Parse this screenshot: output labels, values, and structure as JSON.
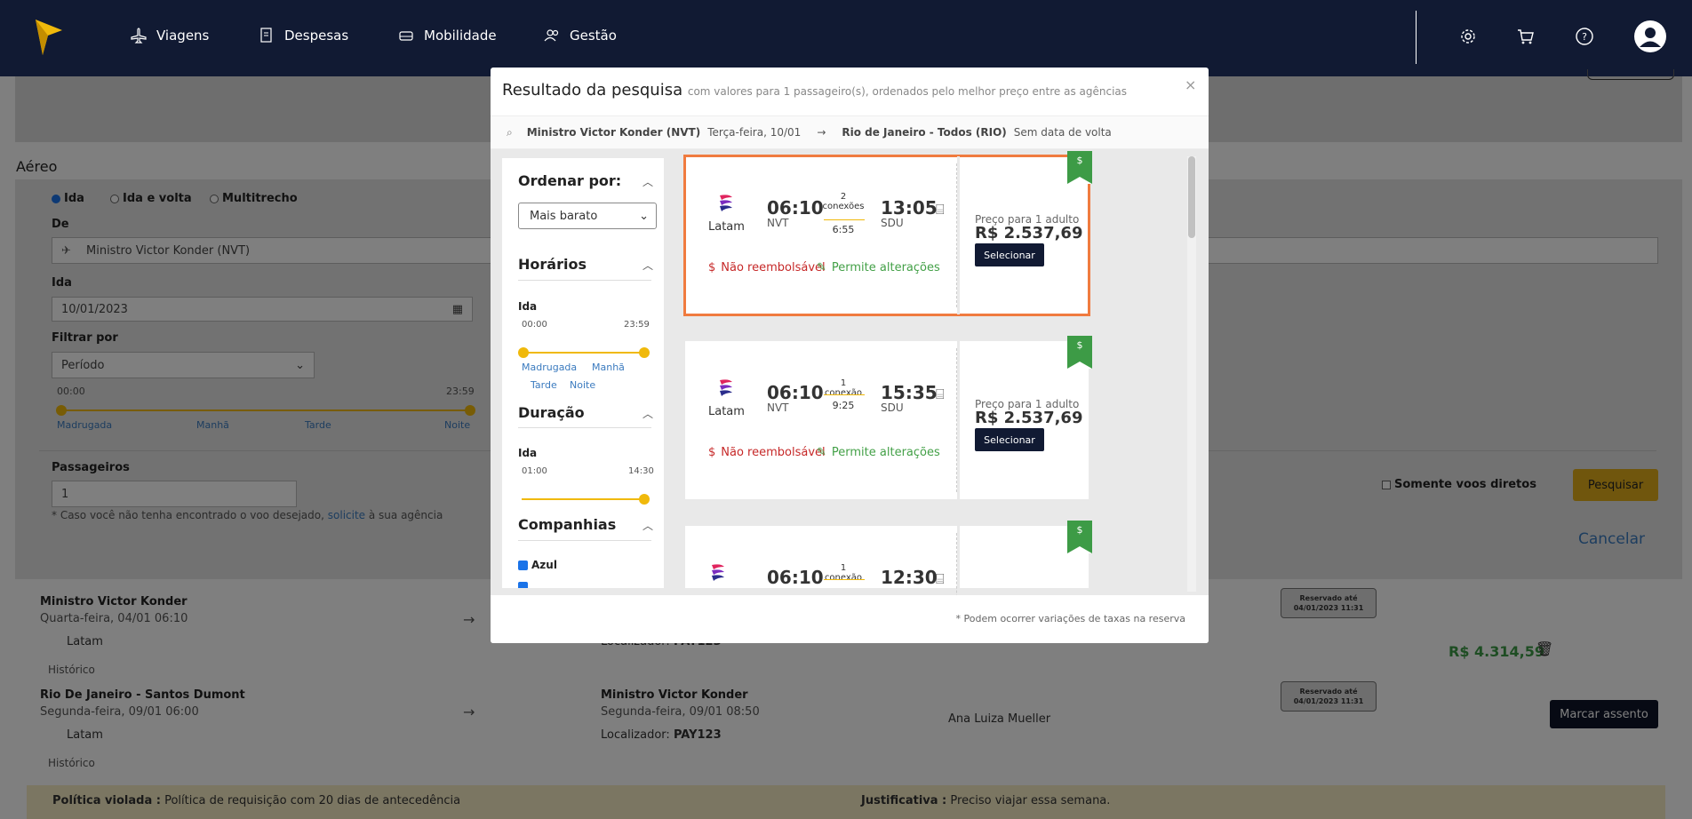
{
  "nav": {
    "items": [
      {
        "label": "Viagens",
        "icon": "plane-icon"
      },
      {
        "label": "Despesas",
        "icon": "receipt-icon"
      },
      {
        "label": "Mobilidade",
        "icon": "car-icon"
      },
      {
        "label": "Gestão",
        "icon": "users-icon"
      }
    ],
    "right_icons": [
      "gear-icon",
      "cart-icon",
      "help-icon",
      "avatar-icon"
    ]
  },
  "page": {
    "section_title": "Aéreo",
    "trip_types": [
      "Ida",
      "Ida e volta",
      "Multitrecho"
    ],
    "selected_trip_type": "Ida",
    "from_label": "De",
    "from_value": "Ministro Victor Konder (NVT)",
    "date_label": "Ida",
    "date_value": "10/01/2023",
    "filter_label": "Filtrar por",
    "filter_value": "Período",
    "range_start": "00:00",
    "range_end": "23:59",
    "periods": [
      "Madrugada",
      "Manhã",
      "Tarde",
      "Noite"
    ],
    "passengers_label": "Passageiros",
    "passengers_value": "1",
    "note_prefix": "* Caso você não tenha encontrado o voo desejado,",
    "note_link": "solicite",
    "note_suffix": "à sua agência",
    "direct_label": "Somente voos diretos",
    "search_button": "Pesquisar",
    "cancel_link": "Cancelar"
  },
  "bookings": [
    {
      "origin": "Ministro Victor Konder",
      "date": "Quarta-feira, 04/01 06:10",
      "airline": "Latam",
      "history": "Histórico",
      "locator_label": "Localizador:",
      "locator": "PAY123",
      "reserved": "Reservado até",
      "reserved_date": "04/01/2023 11:31"
    },
    {
      "origin": "Rio De Janeiro - Santos Dumont",
      "date": "Segunda-feira, 09/01 06:00",
      "airline": "Latam",
      "history": "Histórico",
      "dest": "Ministro Victor Konder",
      "dest_date": "Segunda-feira, 09/01 08:50",
      "locator_label": "Localizador:",
      "locator": "PAY123",
      "passenger": "Ana Luiza Mueller",
      "reserved": "Reservado até",
      "reserved_date": "04/01/2023 11:31"
    }
  ],
  "total_price": "R$ 4.314,59",
  "seat_button": "Marcar assento",
  "policy": {
    "label": "Política violada :",
    "text": "Política de requisição com 20 dias de antecedência",
    "just_label": "Justificativa :",
    "just_text": "Preciso viajar essa semana."
  },
  "modal": {
    "title": "Resultado da pesquisa",
    "subtitle": "com valores para 1 passageiro(s), ordenados pelo melhor preço entre as agências",
    "close": "×",
    "route_from": "Ministro Victor Konder (NVT)",
    "route_date": "Terça-feira, 10/01",
    "route_arrow": "→",
    "route_to": "Rio de Janeiro - Todos (RIO)",
    "route_return": "Sem data de volta",
    "footer_note": "* Podem ocorrer variações de taxas na reserva",
    "filters": {
      "order_title": "Ordenar por:",
      "order_value": "Mais barato",
      "schedule_title": "Horários",
      "ida": "Ida",
      "sched_start": "00:00",
      "sched_end": "23:59",
      "periods": [
        "Madrugada",
        "Manhã",
        "Tarde",
        "Noite"
      ],
      "duration_title": "Duração",
      "dur_start": "01:00",
      "dur_end": "14:30",
      "companies_title": "Companhias",
      "company": "Azul"
    },
    "flights": [
      {
        "airline": "Latam",
        "dep": "06:10",
        "dep_code": "NVT",
        "conn": "2 conexões",
        "dur": "6:55",
        "arr": "13:05",
        "arr_code": "SDU",
        "refund": "Não reembolsável",
        "changes": "Permite alterações",
        "price_label": "Preço para 1 adulto",
        "price": "R$ 2.537,69",
        "button": "Selecionar",
        "badge": "$"
      },
      {
        "airline": "Latam",
        "dep": "06:10",
        "dep_code": "NVT",
        "conn": "1 conexão",
        "dur": "9:25",
        "arr": "15:35",
        "arr_code": "SDU",
        "refund": "Não reembolsável",
        "changes": "Permite alterações",
        "price_label": "Preço para 1 adulto",
        "price": "R$ 2.537,69",
        "button": "Selecionar",
        "badge": "$"
      },
      {
        "airline": "Latam",
        "dep": "06:10",
        "conn": "1 conexão",
        "arr": "12:30",
        "badge": "$"
      }
    ]
  }
}
